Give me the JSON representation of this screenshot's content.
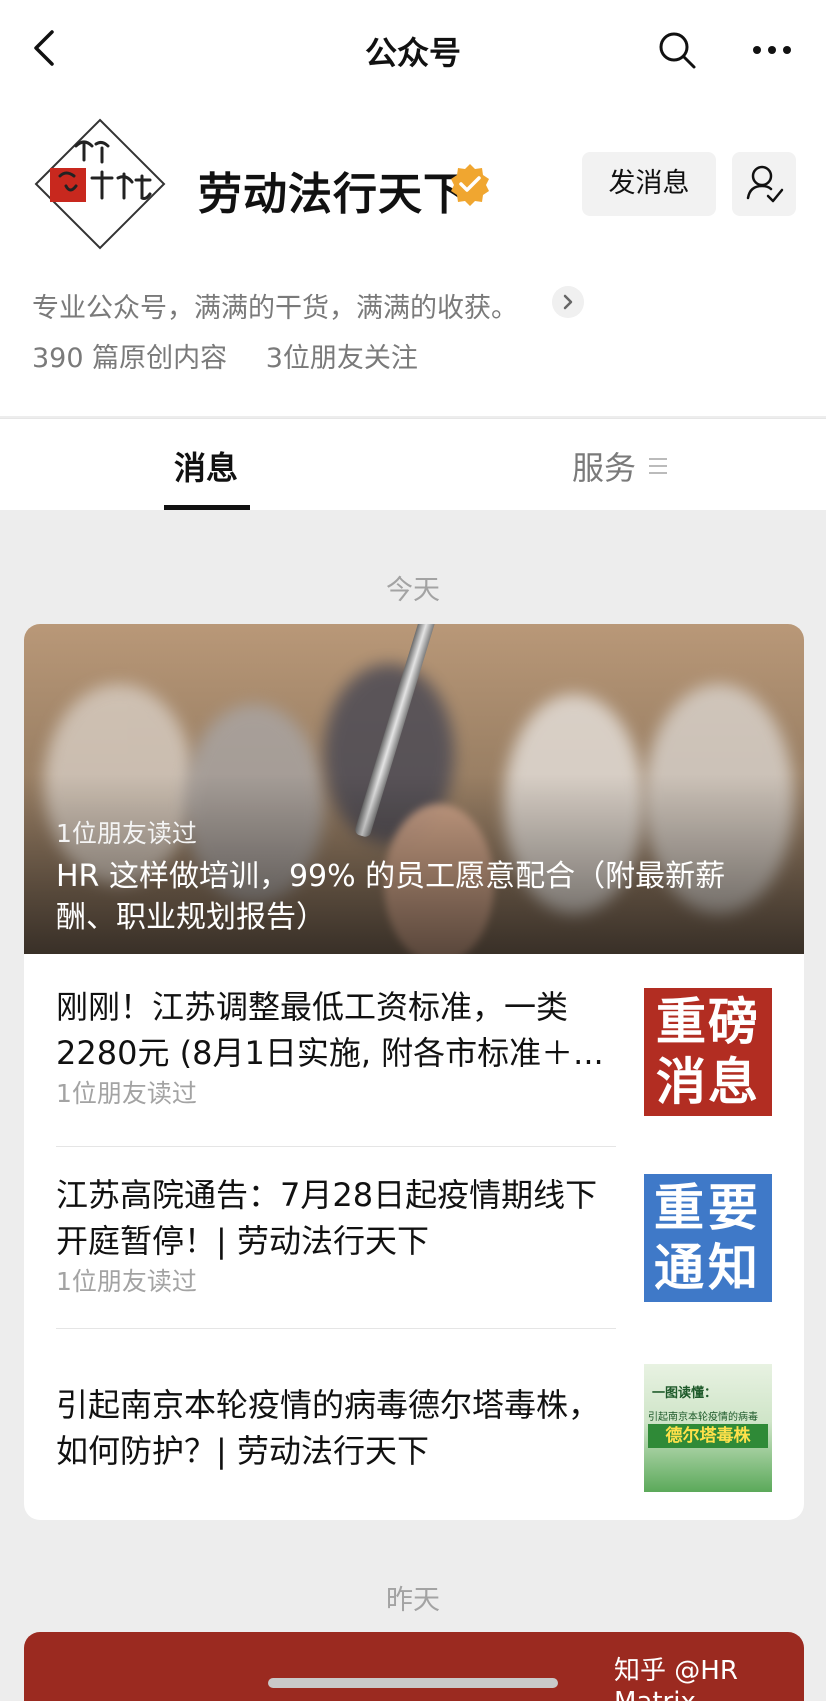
{
  "nav": {
    "title": "公众号",
    "icons": [
      "back-arrow-icon",
      "search-icon",
      "more-icon"
    ]
  },
  "profile": {
    "name": "劳动法行天下",
    "send_message_label": "发消息",
    "description": "专业公众号，满满的干货，满满的收获。",
    "original_count": "390 篇原创内容",
    "friends_following": "3位朋友关注",
    "logo_text": "劳动法行天下",
    "verified_color": "#f0a630"
  },
  "tabs": [
    {
      "label": "消息",
      "active": true
    },
    {
      "label": "服务",
      "active": false
    }
  ],
  "feed": {
    "today_label": "今天",
    "yesterday_label": "昨天",
    "hero": {
      "read_by": "1位朋友读过",
      "title": "HR 这样做培训，99% 的员工愿意配合（附最新薪酬、职业规划报告）"
    },
    "items": [
      {
        "title": "刚刚！江苏调整最低工资标准，一类2280元 (8月1日实施, 附各市标准＋...",
        "read_by": "1位朋友读过",
        "thumb_text": "重磅消息"
      },
      {
        "title": "江苏高院通告：7月28日起疫情期线下开庭暂停！| 劳动法行天下",
        "read_by": "1位朋友读过",
        "thumb_text": "重要通知"
      },
      {
        "title": "引起南京本轮疫情的病毒德尔塔毒株，如何防护？| 劳动法行天下",
        "thumb_text_1": "一图读懂：",
        "thumb_text_2": "引起南京本轮疫情的病毒",
        "thumb_text_3": "德尔塔毒株"
      }
    ]
  },
  "watermark": "知乎 @HR Matrix"
}
